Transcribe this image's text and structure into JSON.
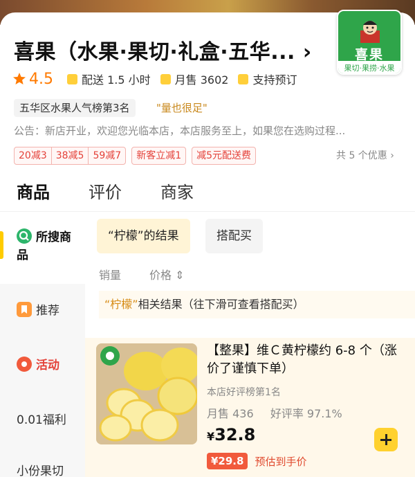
{
  "shop": {
    "title": "喜果（水果·果切·礼盒·五华...",
    "chevron": "›",
    "logo_brand": "喜果",
    "logo_sub": "果切·果捞·水果",
    "rating": "4.5",
    "delivery": "配送 1.5 小时",
    "monthly_sales": "月售 3602",
    "preorder": "支持预订",
    "rank_tag": "五华区水果人气榜第3名",
    "quote_tag": "\"量也很足\"",
    "notice": "公告：新店开业，欢迎您光临本店，本店服务至上，如果您在选购过程...",
    "coupons_a": [
      "20减3",
      "38减5",
      "59减7"
    ],
    "coupons_b": "新客立减1",
    "coupons_c": "减5元配送费",
    "coupons_more": "共 5 个优惠 ›"
  },
  "tabs": [
    "商品",
    "评价",
    "商家"
  ],
  "sidebar": {
    "items": [
      "所搜商品",
      "推荐",
      "活动",
      "0.01福利",
      "小份果切"
    ]
  },
  "search": {
    "result_pill": "“柠檬”的结果",
    "combo_pill": "搭配买",
    "sort_sales": "销量",
    "sort_price": "价格 ⇕",
    "hint_query": "“柠檬”",
    "hint_rest": "相关结果（往下滑可查看搭配买）"
  },
  "product": {
    "name": "【整果】维Ｃ黄柠檬约 6-8 个（涨价了谨慎下单）",
    "rank": "本店好评榜第1名",
    "monthly": "月售 436",
    "rating": "好评率 97.1%",
    "yen": "¥",
    "price": "32.8",
    "promo_price": "¥29.8",
    "promo_label": "预估到手价"
  },
  "colors": {
    "accent_yellow": "#ffd12e",
    "brand_green": "#2fa54a",
    "coupon_red": "#e4423a",
    "rating_orange": "#ff7a00"
  }
}
